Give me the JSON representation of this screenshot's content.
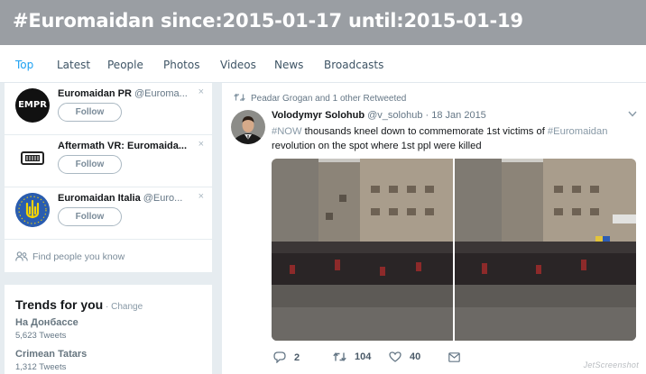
{
  "search": {
    "query": "#Euromaidan since:2015-01-17 until:2015-01-19"
  },
  "nav": {
    "tabs": [
      {
        "label": "Top",
        "active": true
      },
      {
        "label": "Latest"
      },
      {
        "label": "People"
      },
      {
        "label": "Photos"
      },
      {
        "label": "Videos"
      },
      {
        "label": "News"
      },
      {
        "label": "Broadcasts"
      }
    ]
  },
  "who_to_follow": {
    "items": [
      {
        "name": "Euromaidan PR",
        "handle": "@Euroma...",
        "avatar_text": "EMPR",
        "follow_label": "Follow",
        "dismiss": "×"
      },
      {
        "name": "Aftermath VR: Euromaida...",
        "handle": "",
        "follow_label": "Follow",
        "dismiss": "×"
      },
      {
        "name": "Euromaidan Italia",
        "handle": "@Euro...",
        "follow_label": "Follow",
        "dismiss": "×"
      }
    ],
    "find_people_label": "Find people you know"
  },
  "trends": {
    "title": "Trends for you",
    "change_label": " · Change",
    "items": [
      {
        "name": "На Донбассе",
        "count": "5,623 Tweets"
      },
      {
        "name": "Crimean Tatars",
        "count": "1,312 Tweets"
      }
    ]
  },
  "tweet": {
    "retweet_context": "Peadar Grogan and 1 other Retweeted",
    "author_name": "Volodymyr Solohub",
    "handle": "@v_solohub",
    "date": "· 18 Jan 2015",
    "text_parts": [
      {
        "text": "#NOW",
        "type": "hashtag"
      },
      {
        "text": " thousands kneel down to commemorate 1st victims of ",
        "type": "text"
      },
      {
        "text": "#Euromaidan",
        "type": "hashtag"
      },
      {
        "text": " revolution on the spot where 1st ppl were killed",
        "type": "text"
      }
    ],
    "replies": "2",
    "retweets": "104",
    "likes": "40"
  },
  "watermark": "JetScreenshot",
  "colors": {
    "accent": "#1da1f2",
    "header_bg": "#9a9ea3",
    "page_bg": "#e6ecf0"
  }
}
